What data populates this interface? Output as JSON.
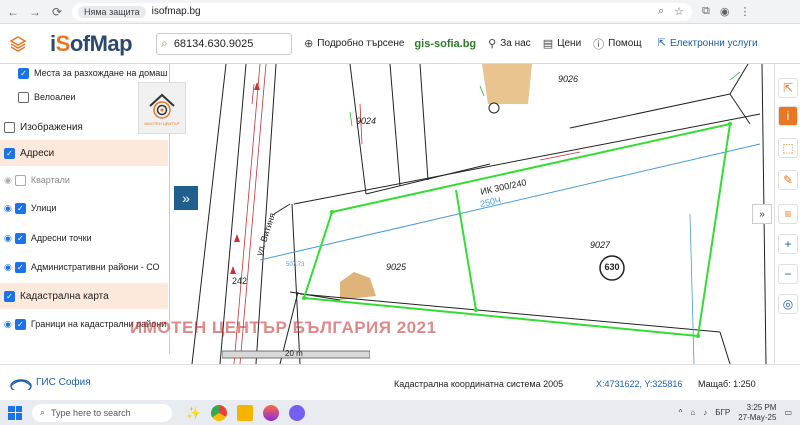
{
  "browser": {
    "security_label": "Няма защита",
    "url": "isofmap.bg"
  },
  "header": {
    "logo_i": "i",
    "logo_s": "S",
    "logo_rest": "ofMap",
    "search_value": "68134.630.9025",
    "advanced_search": "Подробно търсене",
    "gis_link": "gis-sofia.bg",
    "about": "За нас",
    "prices": "Цени",
    "help": "Помощ",
    "eservices": "Електронни услуги"
  },
  "layers": {
    "items": [
      {
        "label": "Места за разхождане на домаш",
        "checked": true
      },
      {
        "label": "Велоалеи",
        "checked": false
      },
      {
        "label": "Изображения",
        "checked": false
      },
      {
        "label": "Адреси",
        "checked": true
      },
      {
        "label": "Квартали",
        "checked": false
      },
      {
        "label": "Улици",
        "checked": true
      },
      {
        "label": "Адресни точки",
        "checked": true
      },
      {
        "label": "Административни райони - СО",
        "checked": true
      },
      {
        "label": "Кадастрална карта",
        "checked": true
      },
      {
        "label": "Граници на кадастрални райони",
        "checked": true
      }
    ]
  },
  "map": {
    "parcel_labels": [
      "9026",
      "9024",
      "9027",
      "9025",
      "242"
    ],
    "parcel_number": "630",
    "street_label": "ул. Витиня",
    "pipe_label": "ИК 300/240",
    "pipe_size": "250Ч",
    "small_label": "507.73",
    "scale_bar": "20 m"
  },
  "banner": "ИМОТЕН ЦЕНТЪР БЪЛГАРИЯ 2021",
  "watermark_small": "ИМОТЕН ЦЕНТЪР",
  "status": {
    "brand": "ГИС София",
    "coord_system": "Кадастрална координатна система 2005",
    "coords": "X:4731622, Y:325816",
    "scale": "Мащаб: 1:250"
  },
  "taskbar": {
    "search_placeholder": "Type here to search",
    "lang": "БГР",
    "time": "3:25 PM",
    "date": "27-May-25"
  }
}
